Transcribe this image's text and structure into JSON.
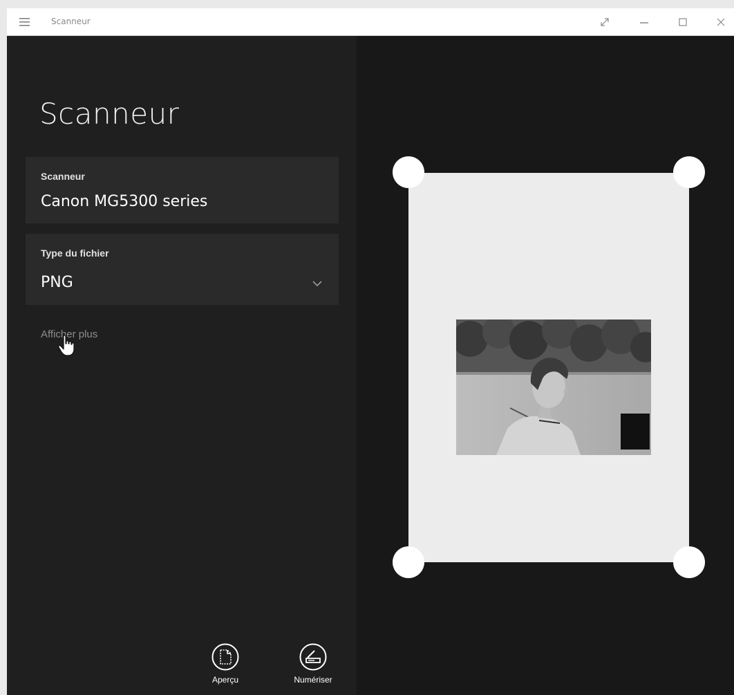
{
  "titlebar": {
    "app_title": "Scanneur"
  },
  "main": {
    "page_title": "Scanneur",
    "scanner": {
      "label": "Scanneur",
      "value": "Canon MG5300 series"
    },
    "file_type": {
      "label": "Type du fichier",
      "value": "PNG"
    },
    "show_more_label": "Afficher plus"
  },
  "actions": {
    "preview_label": "Aperçu",
    "scan_label": "Numériser"
  },
  "icons": {
    "menu": "hamburger-menu-icon",
    "expand": "expand-icon",
    "minimize": "minimize-icon",
    "maximize": "maximize-icon",
    "close": "close-icon",
    "dropdown": "chevron-down-icon",
    "cursor": "hand-pointer-icon",
    "preview": "preview-document-icon",
    "scan": "scanner-icon"
  },
  "colors": {
    "background": "#1f1f1f",
    "card": "#2a2a2a",
    "preview_background": "#181818",
    "sheet": "#ececec",
    "handle": "#ffffff"
  }
}
